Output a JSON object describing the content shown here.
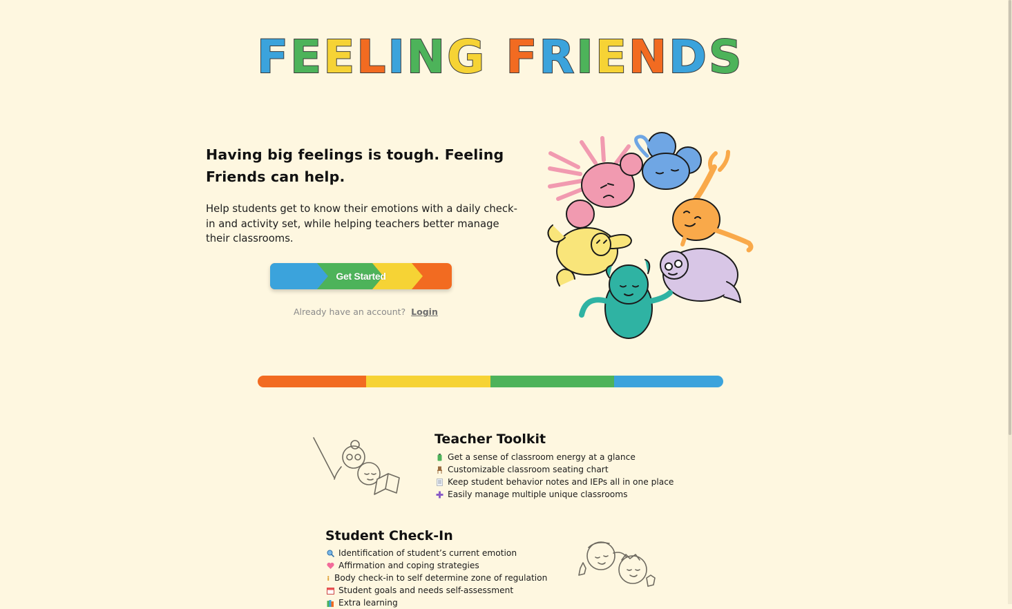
{
  "logo": {
    "letters": [
      {
        "ch": "F",
        "color": "#3ba3dc"
      },
      {
        "ch": "E",
        "color": "#4db35a"
      },
      {
        "ch": "E",
        "color": "#f6d335"
      },
      {
        "ch": "L",
        "color": "#f26b21"
      },
      {
        "ch": "I",
        "color": "#3ba3dc"
      },
      {
        "ch": "N",
        "color": "#4db35a"
      },
      {
        "ch": "G",
        "color": "#f6d335"
      },
      {
        "ch": " ",
        "color": "#000"
      },
      {
        "ch": "F",
        "color": "#f26b21"
      },
      {
        "ch": "R",
        "color": "#3ba3dc"
      },
      {
        "ch": "I",
        "color": "#4db35a"
      },
      {
        "ch": "E",
        "color": "#f6d335"
      },
      {
        "ch": "N",
        "color": "#f26b21"
      },
      {
        "ch": "D",
        "color": "#3ba3dc"
      },
      {
        "ch": "S",
        "color": "#4db35a"
      }
    ]
  },
  "hero": {
    "title": "Having big feelings is tough. Feeling Friends can help.",
    "body": "Help students get to know their emotions with a daily check-in and activity set, while helping teachers better manage their classrooms.",
    "cta_label": "Get Started",
    "login_prompt": "Already have an account?",
    "login_label": "Login"
  },
  "colors": {
    "orange": "#f26b21",
    "yellow": "#f6d335",
    "green": "#4db35a",
    "blue": "#3ba3dc",
    "pink": "#f19ab0",
    "lavender": "#d8c6e6",
    "teal": "#2fb3a3",
    "background": "#fef7e0"
  },
  "divider": {
    "segments": [
      {
        "color": "#f26b21",
        "share": 23.3
      },
      {
        "color": "#f6d335",
        "share": 26.7
      },
      {
        "color": "#4db35a",
        "share": 26.6
      },
      {
        "color": "#3ba3dc",
        "share": 23.4
      }
    ]
  },
  "teacher_toolkit": {
    "title": "Teacher Toolkit",
    "items": [
      {
        "icon": "battery-icon",
        "text": "Get a sense of classroom energy at a glance"
      },
      {
        "icon": "chair-icon",
        "text": "Customizable classroom seating chart"
      },
      {
        "icon": "memo-icon",
        "text": "Keep student behavior notes and IEPs all in one place"
      },
      {
        "icon": "plus-icon",
        "text": "Easily manage multiple unique classrooms"
      }
    ]
  },
  "student_checkin": {
    "title": "Student Check-In",
    "items": [
      {
        "icon": "magnifier-icon",
        "text": "Identification of student’s current emotion"
      },
      {
        "icon": "heart-icon",
        "text": "Affirmation and coping strategies"
      },
      {
        "icon": "person-icon",
        "text": "Body check-in to self determine zone of regulation"
      },
      {
        "icon": "calendar-icon",
        "text": "Student goals and needs self-assessment"
      },
      {
        "icon": "books-icon",
        "text": "Extra learning"
      }
    ]
  }
}
